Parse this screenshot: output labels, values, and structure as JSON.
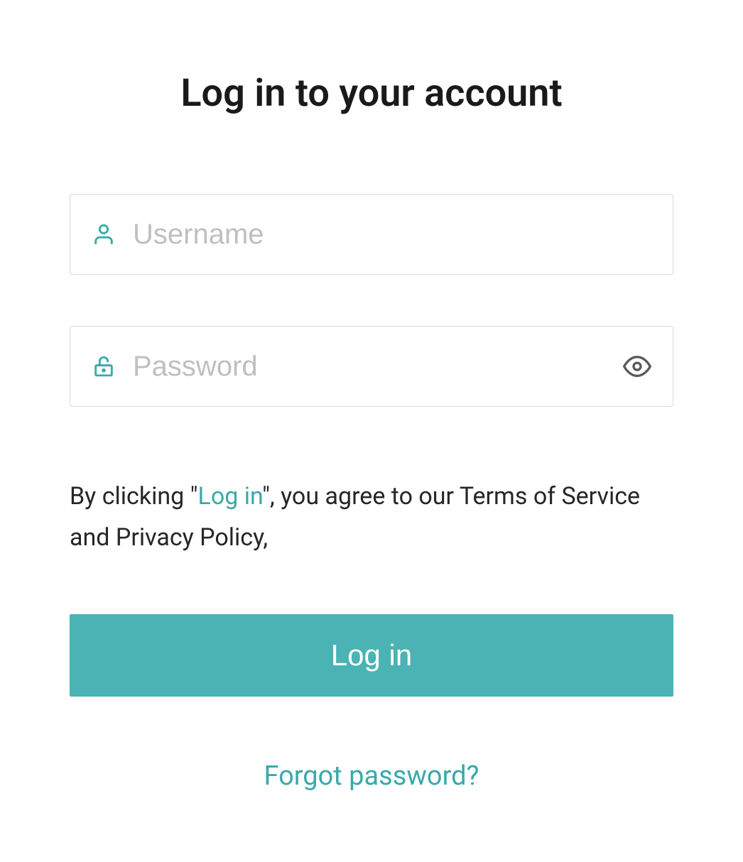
{
  "page": {
    "title": "Log in to your account"
  },
  "form": {
    "username": {
      "placeholder": "Username",
      "value": ""
    },
    "password": {
      "placeholder": "Password",
      "value": ""
    }
  },
  "terms": {
    "prefix": "By clicking \"",
    "link_text": "Log in",
    "suffix": "\", you agree to our Terms of Service and Privacy Policy,"
  },
  "buttons": {
    "login": "Log in"
  },
  "links": {
    "forgot_password": "Forgot password?"
  },
  "icons": {
    "user": "user-icon",
    "lock": "lock-icon",
    "eye": "eye-icon"
  },
  "colors": {
    "accent": "#3aa9a9",
    "button_bg": "#4bb3b3",
    "text": "#1a1a1a",
    "placeholder": "#bfbfbf",
    "border": "#d9d9d9"
  }
}
